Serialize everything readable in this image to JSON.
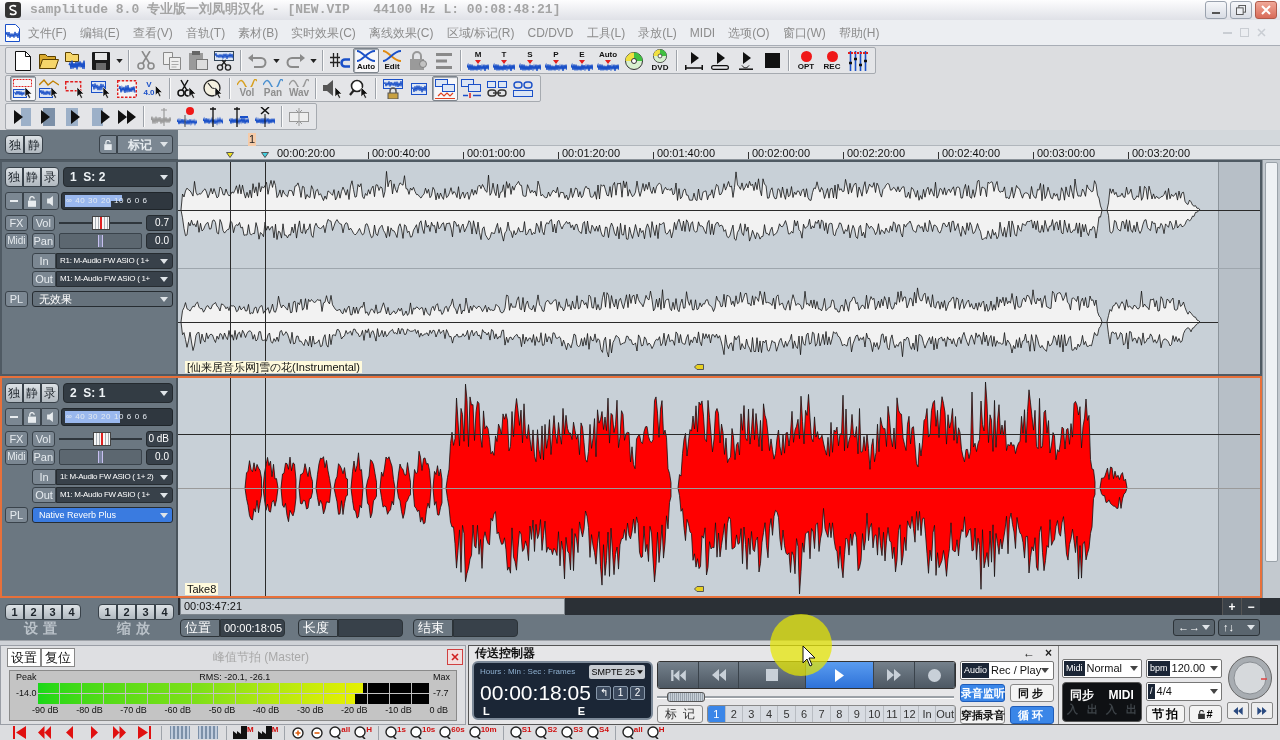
{
  "window": {
    "title": "samplitude 8.0 专业版一刘凤明汉化 - [NEW.VIP   44100 Hz L: 00:08:48:21]"
  },
  "menu": [
    "文件(F)",
    "编辑(E)",
    "查看(V)",
    "音轨(T)",
    "素材(B)",
    "实时效果(C)",
    "离线效果(C)",
    "区域/标记(R)",
    "CD/DVD",
    "工具(L)",
    "录放(L)",
    "MIDI",
    "选项(O)",
    "窗口(W)",
    "帮助(H)"
  ],
  "toolbars": [
    [
      {
        "label": "Auto",
        "selected": true
      },
      {
        "label": "Edit",
        "selected": false
      },
      {
        "label": "M"
      },
      {
        "label": "T"
      },
      {
        "label": "S"
      },
      {
        "label": "P"
      },
      {
        "label": "E"
      },
      {
        "label": "Auto"
      },
      {
        "label": "DVD"
      },
      {
        "label": "OPT"
      },
      {
        "label": "REC"
      }
    ],
    [
      {
        "selected": true
      },
      {
        "selected": false
      },
      {
        "selected": false
      },
      {
        "selected": false
      },
      {
        "selected": false
      },
      {
        "label": "V",
        "sublabel": "4.0",
        "selected": false
      },
      {
        "label": "Vol"
      },
      {
        "label": "Pan"
      },
      {
        "label": "Wav"
      },
      {
        "selected": true
      },
      {
        "selected": false
      },
      {
        "selected": false
      },
      {
        "selected": false
      }
    ]
  ],
  "track_header": {
    "buttons": [
      "独",
      "静"
    ],
    "marker_menu": "标记"
  },
  "ruler": {
    "marker": "1",
    "labels": [
      "00:00:20:00",
      "00:00:40:00",
      "00:01:00:00",
      "00:01:20:00",
      "00:01:40:00",
      "00:02:00:00",
      "00:02:20:00",
      "00:02:40:00",
      "00:03:00:00",
      "00:03:20:00"
    ]
  },
  "tracks": [
    {
      "selected": false,
      "buttons": [
        "独",
        "静",
        "录"
      ],
      "name": "1  S: 2",
      "meter_scale": "∞ 40 30 20 10 6 0 6",
      "meter": [
        {
          "level": 0.55
        },
        {
          "level": 0.44
        }
      ],
      "fx_button": "FX",
      "midi_button": "Midi",
      "volume": {
        "label": "Vol",
        "level": 0.5,
        "value": "0.7"
      },
      "pan": {
        "label": "Pan",
        "level": 0.5,
        "value": "0.0"
      },
      "input": {
        "label": "In",
        "value": "R1: M-Audio FW ASIO ( 1+"
      },
      "output": {
        "label": "Out",
        "value": "M1: M-Audio FW ASIO ( 1+"
      },
      "plugins": {
        "label": "PL",
        "value": "无效果",
        "highlighted": false
      },
      "clip": {
        "kind": "stereo",
        "color": "#f2f2f2",
        "name": "[仙来居音乐网]雪の花(Instrumental)"
      }
    },
    {
      "selected": true,
      "buttons": [
        "独",
        "静",
        "录"
      ],
      "name": "2  S: 1",
      "meter_scale": "∞ 40 30 20 10 6 0 6",
      "meter": [
        {
          "level": 0.53
        },
        {
          "level": 0.53
        }
      ],
      "fx_button": "FX",
      "midi_button": "Midi",
      "volume": {
        "label": "Vol",
        "level": 0.52,
        "value": "0 dB"
      },
      "pan": {
        "label": "Pan",
        "level": 0.5,
        "value": "0.0"
      },
      "input": {
        "label": "In",
        "value": "1l: M-Audio FW ASIO ( 1+ 2)"
      },
      "output": {
        "label": "Out",
        "value": "M1: M-Audio FW ASIO ( 1+"
      },
      "plugins": {
        "label": "PL",
        "value": "Native Reverb Plus",
        "highlighted": true
      },
      "clip": {
        "kind": "mono",
        "color": "#ff0000",
        "name": "Take8"
      }
    }
  ],
  "timeline_scroll": {
    "position": "00:03:47:21"
  },
  "zoom_buttons": [
    "+",
    "−"
  ],
  "presets": [
    {
      "buttons": [
        "1",
        "2",
        "3",
        "4"
      ],
      "label": "设置"
    },
    {
      "buttons": [
        "1",
        "2",
        "3",
        "4"
      ],
      "label": "缩放"
    }
  ],
  "fields": [
    {
      "label": "位置",
      "value": "00:00:18:05"
    },
    {
      "label": "长度"
    },
    {
      "label": "结束"
    }
  ],
  "view_dropdowns": [
    "←→",
    "↑↓"
  ],
  "peak_meter": {
    "tabs": [
      "设置",
      "复位"
    ],
    "title": "峰值节拍 (Master)",
    "peak_label": "Peak",
    "rms": "RMS: -20.1, -26.1",
    "max_label": "Max",
    "peak_value": "-14.0",
    "max_value": "-7.7",
    "channels": [
      {
        "level": 0.83
      },
      {
        "level": 0.81
      }
    ],
    "scale": [
      "-90 dB",
      "-80 dB",
      "-70 dB",
      "-60 dB",
      "-50 dB",
      "-40 dB",
      "-30 dB",
      "-20 dB",
      "-10 dB",
      "0 dB"
    ]
  },
  "transport": {
    "title": "传送控制器",
    "header_buttons": [
      "←",
      "×"
    ],
    "time_header": "Hours : Min : Sec : Frames",
    "format": "SMPTE 25",
    "time": "00:00:18:05",
    "time_buttons": [
      "↰",
      "1",
      "2"
    ],
    "left_label": "L",
    "right_label": "E",
    "buttons": [
      {
        "selected": false
      },
      {
        "selected": false
      },
      {
        "selected": false
      },
      {
        "selected": true
      },
      {
        "selected": false
      },
      {
        "selected": false
      }
    ],
    "shuttle": {
      "level": 0.04
    },
    "marker_button": "标记",
    "markers": [
      {
        "label": "1",
        "selected": true
      },
      {
        "label": "2",
        "selected": false
      },
      {
        "label": "3",
        "selected": false
      },
      {
        "label": "4",
        "selected": false
      },
      {
        "label": "5",
        "selected": false
      },
      {
        "label": "6",
        "selected": false
      },
      {
        "label": "7",
        "selected": false
      },
      {
        "label": "8",
        "selected": false
      },
      {
        "label": "9",
        "selected": false
      },
      {
        "label": "10",
        "selected": false
      },
      {
        "label": "11",
        "selected": false
      },
      {
        "label": "12",
        "selected": false
      },
      {
        "label": "In",
        "selected": false
      },
      {
        "label": "Out",
        "selected": false
      }
    ],
    "mode": {
      "tag": "Audio",
      "value": "Rec / Play"
    },
    "toggles": [
      {
        "label": "录音监听",
        "on": true
      },
      {
        "label": "同步",
        "on": false
      },
      {
        "label": "穿插录音",
        "on": false
      },
      {
        "label": "循环",
        "on": true
      }
    ]
  },
  "sync": {
    "midi": {
      "tag": "Midi",
      "value": "Normal"
    },
    "panel": {
      "labels": [
        "同步",
        "MIDI"
      ],
      "indicators": [
        "入",
        "出",
        "入",
        "出"
      ]
    },
    "bpm": {
      "tag": "bpm",
      "value": "120.00"
    },
    "signature": {
      "tag": "/",
      "value": "4/4"
    },
    "metronome": "节拍",
    "lock_button": "#"
  },
  "bottom_toolbar": [
    "M",
    "M",
    "all",
    "H",
    "1s",
    "10s",
    "60s",
    "10m",
    "S1",
    "S2",
    "S3",
    "S4",
    "all",
    "H"
  ]
}
